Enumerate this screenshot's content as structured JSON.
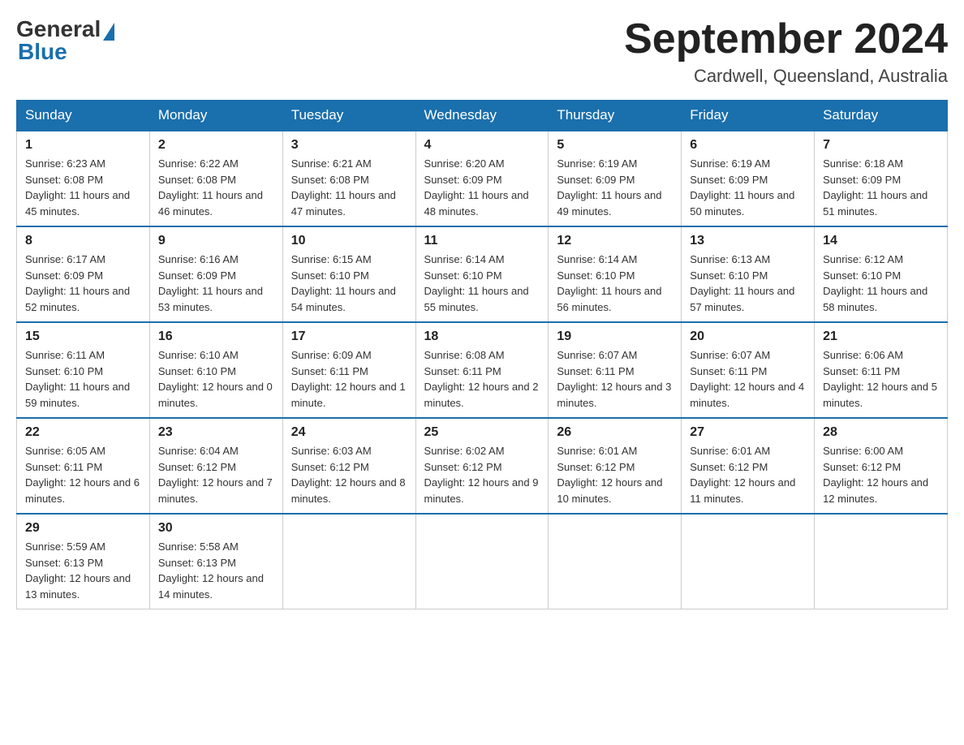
{
  "header": {
    "logo_general": "General",
    "logo_blue": "Blue",
    "month_title": "September 2024",
    "location": "Cardwell, Queensland, Australia"
  },
  "days_of_week": [
    "Sunday",
    "Monday",
    "Tuesday",
    "Wednesday",
    "Thursday",
    "Friday",
    "Saturday"
  ],
  "weeks": [
    [
      {
        "day": "1",
        "sunrise": "6:23 AM",
        "sunset": "6:08 PM",
        "daylight": "11 hours and 45 minutes."
      },
      {
        "day": "2",
        "sunrise": "6:22 AM",
        "sunset": "6:08 PM",
        "daylight": "11 hours and 46 minutes."
      },
      {
        "day": "3",
        "sunrise": "6:21 AM",
        "sunset": "6:08 PM",
        "daylight": "11 hours and 47 minutes."
      },
      {
        "day": "4",
        "sunrise": "6:20 AM",
        "sunset": "6:09 PM",
        "daylight": "11 hours and 48 minutes."
      },
      {
        "day": "5",
        "sunrise": "6:19 AM",
        "sunset": "6:09 PM",
        "daylight": "11 hours and 49 minutes."
      },
      {
        "day": "6",
        "sunrise": "6:19 AM",
        "sunset": "6:09 PM",
        "daylight": "11 hours and 50 minutes."
      },
      {
        "day": "7",
        "sunrise": "6:18 AM",
        "sunset": "6:09 PM",
        "daylight": "11 hours and 51 minutes."
      }
    ],
    [
      {
        "day": "8",
        "sunrise": "6:17 AM",
        "sunset": "6:09 PM",
        "daylight": "11 hours and 52 minutes."
      },
      {
        "day": "9",
        "sunrise": "6:16 AM",
        "sunset": "6:09 PM",
        "daylight": "11 hours and 53 minutes."
      },
      {
        "day": "10",
        "sunrise": "6:15 AM",
        "sunset": "6:10 PM",
        "daylight": "11 hours and 54 minutes."
      },
      {
        "day": "11",
        "sunrise": "6:14 AM",
        "sunset": "6:10 PM",
        "daylight": "11 hours and 55 minutes."
      },
      {
        "day": "12",
        "sunrise": "6:14 AM",
        "sunset": "6:10 PM",
        "daylight": "11 hours and 56 minutes."
      },
      {
        "day": "13",
        "sunrise": "6:13 AM",
        "sunset": "6:10 PM",
        "daylight": "11 hours and 57 minutes."
      },
      {
        "day": "14",
        "sunrise": "6:12 AM",
        "sunset": "6:10 PM",
        "daylight": "11 hours and 58 minutes."
      }
    ],
    [
      {
        "day": "15",
        "sunrise": "6:11 AM",
        "sunset": "6:10 PM",
        "daylight": "11 hours and 59 minutes."
      },
      {
        "day": "16",
        "sunrise": "6:10 AM",
        "sunset": "6:10 PM",
        "daylight": "12 hours and 0 minutes."
      },
      {
        "day": "17",
        "sunrise": "6:09 AM",
        "sunset": "6:11 PM",
        "daylight": "12 hours and 1 minute."
      },
      {
        "day": "18",
        "sunrise": "6:08 AM",
        "sunset": "6:11 PM",
        "daylight": "12 hours and 2 minutes."
      },
      {
        "day": "19",
        "sunrise": "6:07 AM",
        "sunset": "6:11 PM",
        "daylight": "12 hours and 3 minutes."
      },
      {
        "day": "20",
        "sunrise": "6:07 AM",
        "sunset": "6:11 PM",
        "daylight": "12 hours and 4 minutes."
      },
      {
        "day": "21",
        "sunrise": "6:06 AM",
        "sunset": "6:11 PM",
        "daylight": "12 hours and 5 minutes."
      }
    ],
    [
      {
        "day": "22",
        "sunrise": "6:05 AM",
        "sunset": "6:11 PM",
        "daylight": "12 hours and 6 minutes."
      },
      {
        "day": "23",
        "sunrise": "6:04 AM",
        "sunset": "6:12 PM",
        "daylight": "12 hours and 7 minutes."
      },
      {
        "day": "24",
        "sunrise": "6:03 AM",
        "sunset": "6:12 PM",
        "daylight": "12 hours and 8 minutes."
      },
      {
        "day": "25",
        "sunrise": "6:02 AM",
        "sunset": "6:12 PM",
        "daylight": "12 hours and 9 minutes."
      },
      {
        "day": "26",
        "sunrise": "6:01 AM",
        "sunset": "6:12 PM",
        "daylight": "12 hours and 10 minutes."
      },
      {
        "day": "27",
        "sunrise": "6:01 AM",
        "sunset": "6:12 PM",
        "daylight": "12 hours and 11 minutes."
      },
      {
        "day": "28",
        "sunrise": "6:00 AM",
        "sunset": "6:12 PM",
        "daylight": "12 hours and 12 minutes."
      }
    ],
    [
      {
        "day": "29",
        "sunrise": "5:59 AM",
        "sunset": "6:13 PM",
        "daylight": "12 hours and 13 minutes."
      },
      {
        "day": "30",
        "sunrise": "5:58 AM",
        "sunset": "6:13 PM",
        "daylight": "12 hours and 14 minutes."
      },
      null,
      null,
      null,
      null,
      null
    ]
  ],
  "labels": {
    "sunrise": "Sunrise:",
    "sunset": "Sunset:",
    "daylight": "Daylight:"
  }
}
